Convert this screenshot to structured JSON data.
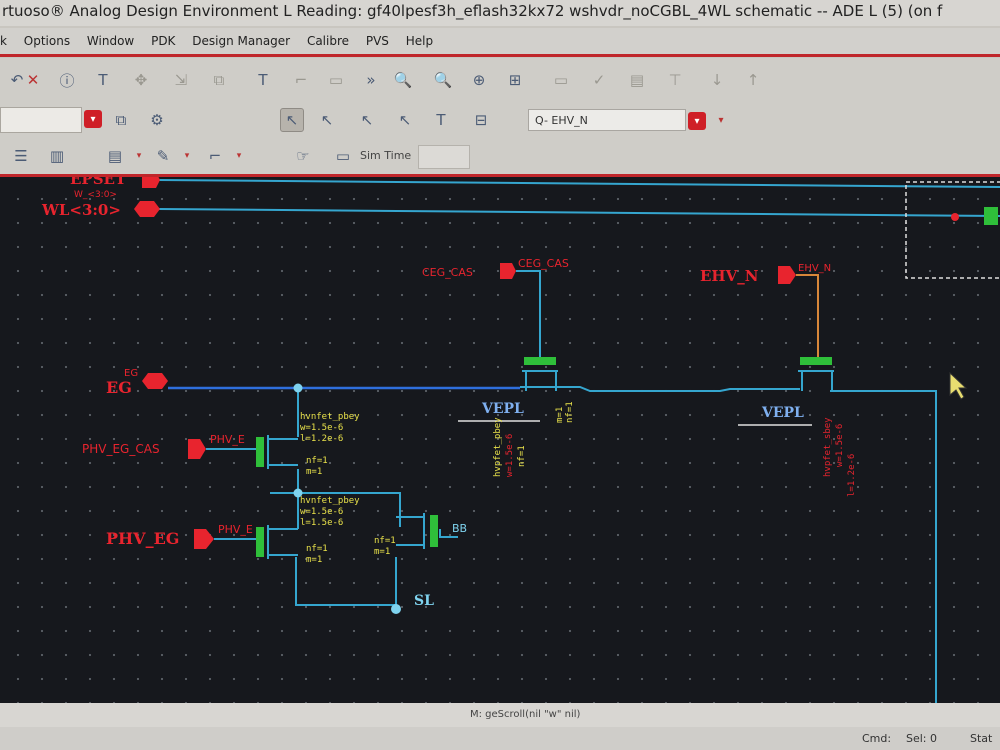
{
  "window": {
    "title": "rtuoso® Analog Design Environment L Reading: gf40lpesf3h_eflash32kx72 wshvdr_noCGBL_4WL schematic -- ADE L (5) (on f"
  },
  "menu": [
    "k",
    "Options",
    "Window",
    "PDK",
    "Design Manager",
    "Calibre",
    "PVS",
    "Help"
  ],
  "toolbar": {
    "search_value": "Q- EHV_N",
    "sim_time_label": "Sim Time"
  },
  "schematic": {
    "pins": {
      "epset": "EPSET",
      "epset_sub": "W_<3:0>",
      "wl": "WL<3:0>",
      "eg": "EG",
      "eg_net": "EG",
      "phv_eg_cas": "PHV_EG_CAS",
      "phv_eg_cas_net": "PHV_E",
      "phv_eg": "PHV_EG",
      "phv_eg_net": "PHV_E",
      "ceg_cas": "CEG_CAS",
      "ceg_cas_net": "CEG_CAS",
      "ehv_n": "EHV_N",
      "ehv_n_net": "EHV_N",
      "bb": "BB",
      "sl": "SL"
    },
    "instances": {
      "vepl1": "VEPL",
      "vepl2": "VEPL",
      "t1_model": "hvnfet_pbey",
      "t1_w": "w=1.5e-6",
      "t1_l": "l=1.2e-6",
      "t1_nf": "nf=1",
      "t1_m": "m=1",
      "t2_model": "hvnfet_pbey",
      "t2_w": "w=1.5e-6",
      "t2_l": "l=1.5e-6",
      "t2_nf": "nf=1",
      "t2_m": "m=1",
      "t3_nf": "nf=1",
      "t3_m": "m=1"
    }
  },
  "status": {
    "message": "M: geScroll(nil \"w\" nil)",
    "cmd": "Cmd:",
    "sel": "Sel: 0",
    "stat": "Stat"
  },
  "colors": {
    "wire": "#35a6cf",
    "pin": "#e8242e",
    "device": "#2fbf3a",
    "property": "#e8e14a",
    "selection": "#c0262b"
  }
}
